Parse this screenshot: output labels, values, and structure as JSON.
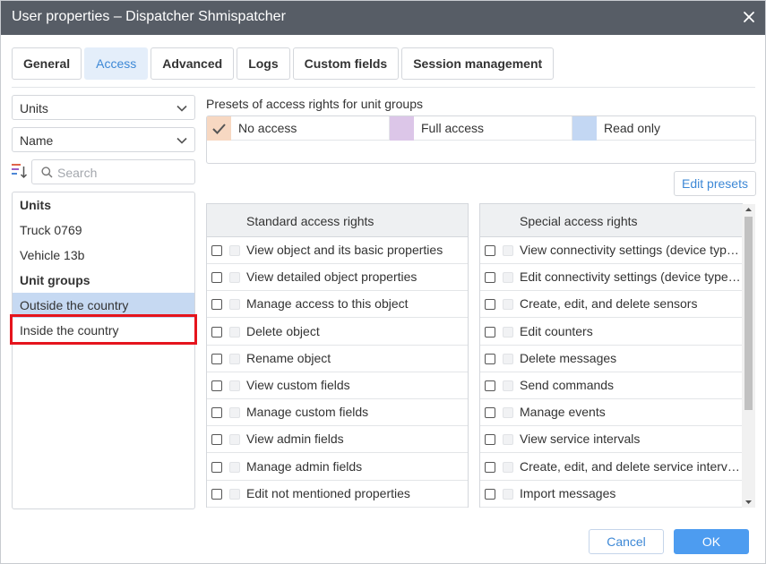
{
  "window": {
    "title": "User properties – Dispatcher Shmispatcher"
  },
  "tabs": [
    {
      "label": "General"
    },
    {
      "label": "Access",
      "active": true
    },
    {
      "label": "Advanced"
    },
    {
      "label": "Logs"
    },
    {
      "label": "Custom fields"
    },
    {
      "label": "Session management"
    }
  ],
  "filters": {
    "type_select": "Units",
    "sort_select": "Name",
    "search_placeholder": "Search"
  },
  "unit_list": [
    {
      "label": "Units",
      "kind": "header"
    },
    {
      "label": "Truck 0769",
      "kind": "item"
    },
    {
      "label": "Vehicle 13b",
      "kind": "item"
    },
    {
      "label": "Unit groups",
      "kind": "header"
    },
    {
      "label": "Outside the country",
      "kind": "item",
      "selected": true
    },
    {
      "label": "Inside the country",
      "kind": "item",
      "highlighted": true
    }
  ],
  "presets": {
    "title": "Presets of access rights for unit groups",
    "items": [
      {
        "label": "No access",
        "color": "#f7d8c2",
        "checked": true
      },
      {
        "label": "Full access",
        "color": "#dcc6e8"
      },
      {
        "label": "Read only",
        "color": "#c3d7f3"
      }
    ],
    "edit_label": "Edit presets"
  },
  "standard_rights": {
    "title": "Standard access rights",
    "items": [
      "View object and its basic properties",
      "View detailed object properties",
      "Manage access to this object",
      "Delete object",
      "Rename object",
      "View custom fields",
      "Manage custom fields",
      "View admin fields",
      "Manage admin fields",
      "Edit not mentioned properties"
    ]
  },
  "special_rights": {
    "title": "Special access rights",
    "items": [
      "View connectivity settings (device typ…",
      "Edit connectivity settings (device type…",
      "Create, edit, and delete sensors",
      "Edit counters",
      "Delete messages",
      "Send commands",
      "Manage events",
      "View service intervals",
      "Create, edit, and delete service interv…",
      "Import messages"
    ]
  },
  "footer": {
    "cancel_label": "Cancel",
    "ok_label": "OK"
  }
}
